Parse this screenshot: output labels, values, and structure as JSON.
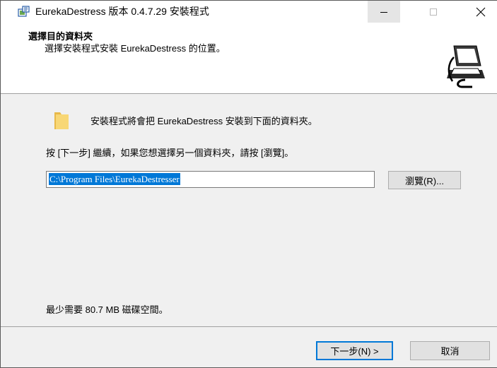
{
  "window": {
    "title": "EurekaDestress 版本 0.4.7.29 安裝程式",
    "minimize_glyph": "—",
    "maximize_glyph": "☐",
    "close_glyph": "✕"
  },
  "header": {
    "title": "選擇目的資料夾",
    "subtitle": "選擇安裝程式安裝 EurekaDestress 的位置。",
    "image": "installer-computer-icon"
  },
  "body": {
    "folder_icon": "folder-icon",
    "intro": "安裝程式將會把 EurekaDestress 安裝到下面的資料夾。",
    "instructions": "按 [下一步] 繼續，如果您想選擇另一個資料夾，請按 [瀏覽]。",
    "install_path": "C:\\Program Files\\EurekaDestresser",
    "browse_label": "瀏覽(R)...",
    "space_required": "最少需要 80.7 MB 磁碟空間。"
  },
  "footer": {
    "next_label": "下一步(N) >",
    "cancel_label": "取消"
  },
  "colors": {
    "selection": "#0078d7",
    "default_button_border": "#0078d7",
    "folder": "#f8d775"
  }
}
